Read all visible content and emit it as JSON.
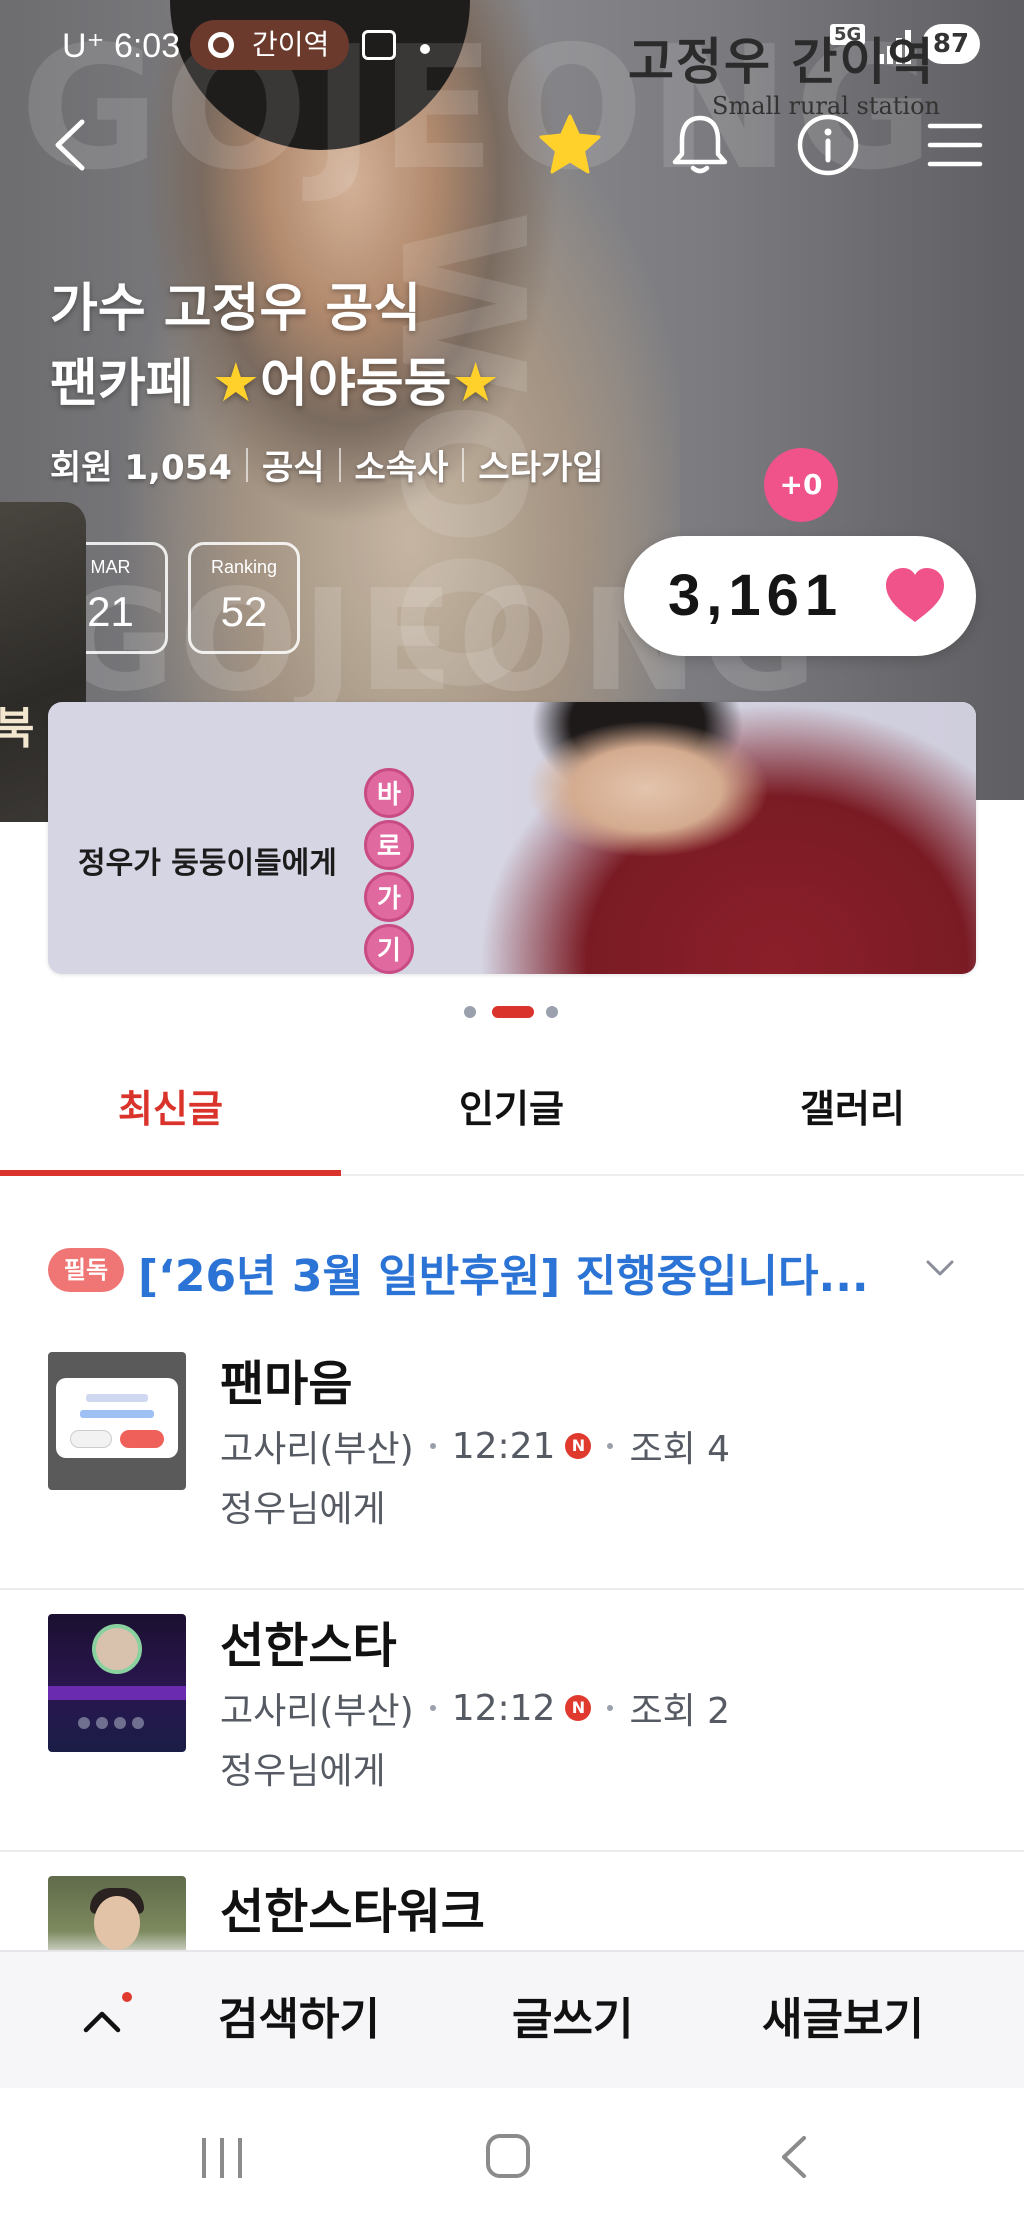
{
  "status_bar": {
    "time": "6:03",
    "carrier_prefix": "U⁺",
    "location_chip": "간이역",
    "network": "5G",
    "battery": "87"
  },
  "hero": {
    "brand_logo": "고정우 간이역",
    "brand_sub": "Small rural station",
    "cafe_title_line1": "가수 고정우 공식",
    "cafe_title_line2_prefix": "팬카페 ",
    "cafe_title_line2_name": "어야둥둥",
    "star_glyph": "★",
    "members_label": "회원 1,054",
    "meta_official": "공식",
    "meta_agency": "소속사",
    "meta_star_join": "스타가입",
    "plus_badge": "+0",
    "side_thumb_glyph": "북",
    "stats": [
      {
        "label": "MAR",
        "value": "21"
      },
      {
        "label": "Ranking",
        "value": "52"
      }
    ],
    "like_count": "3,161"
  },
  "banner": {
    "text": "정우가 둥둥이들에게",
    "cta_chars": [
      "바",
      "로",
      "가",
      "기"
    ],
    "cta_arrow": "→",
    "active_index": 1,
    "count": 3
  },
  "tabs": [
    {
      "label": "최신글",
      "active": true
    },
    {
      "label": "인기글",
      "active": false
    },
    {
      "label": "갤러리",
      "active": false
    }
  ],
  "notice": {
    "badge": "필독",
    "text": "[‘26년 3월 일반후원] 진행중입니다..."
  },
  "posts": [
    {
      "title": "팬마음",
      "author": "고사리(부산)",
      "time": "12:21",
      "new_badge": "N",
      "views": "조회 4",
      "board": "정우님에게"
    },
    {
      "title": "선한스타",
      "author": "고사리(부산)",
      "time": "12:12",
      "new_badge": "N",
      "views": "조회 2",
      "board": "정우님에게"
    },
    {
      "title": "선한스타워크",
      "author": "",
      "time": "",
      "new_badge": "",
      "views": "",
      "board": ""
    }
  ],
  "action_bar": {
    "search": "검색하기",
    "write": "글쓰기",
    "new_posts": "새글보기"
  },
  "colors": {
    "accent_red": "#d9332c",
    "heart_pink": "#f0528a",
    "notice_blue": "#2b74d6",
    "star_yellow": "#ffd12a"
  },
  "icons": {
    "back": "chevron-left-icon",
    "favorite": "star-icon",
    "notifications": "bell-icon",
    "info": "info-icon",
    "menu": "hamburger-icon",
    "like": "heart-icon",
    "scroll_top": "chevron-up-icon"
  }
}
